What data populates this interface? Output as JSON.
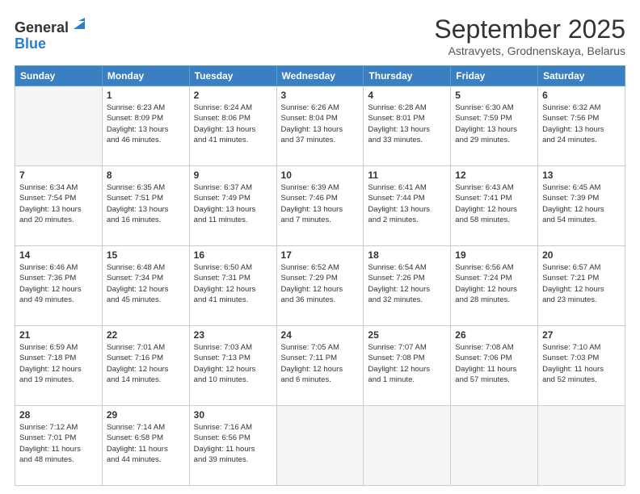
{
  "header": {
    "logo": {
      "line1": "General",
      "line2": "Blue"
    },
    "title": "September 2025",
    "subtitle": "Astravyets, Grodnenskaya, Belarus"
  },
  "calendar": {
    "weekdays": [
      "Sunday",
      "Monday",
      "Tuesday",
      "Wednesday",
      "Thursday",
      "Friday",
      "Saturday"
    ],
    "weeks": [
      [
        {
          "day": "",
          "info": ""
        },
        {
          "day": "1",
          "info": "Sunrise: 6:23 AM\nSunset: 8:09 PM\nDaylight: 13 hours\nand 46 minutes."
        },
        {
          "day": "2",
          "info": "Sunrise: 6:24 AM\nSunset: 8:06 PM\nDaylight: 13 hours\nand 41 minutes."
        },
        {
          "day": "3",
          "info": "Sunrise: 6:26 AM\nSunset: 8:04 PM\nDaylight: 13 hours\nand 37 minutes."
        },
        {
          "day": "4",
          "info": "Sunrise: 6:28 AM\nSunset: 8:01 PM\nDaylight: 13 hours\nand 33 minutes."
        },
        {
          "day": "5",
          "info": "Sunrise: 6:30 AM\nSunset: 7:59 PM\nDaylight: 13 hours\nand 29 minutes."
        },
        {
          "day": "6",
          "info": "Sunrise: 6:32 AM\nSunset: 7:56 PM\nDaylight: 13 hours\nand 24 minutes."
        }
      ],
      [
        {
          "day": "7",
          "info": "Sunrise: 6:34 AM\nSunset: 7:54 PM\nDaylight: 13 hours\nand 20 minutes."
        },
        {
          "day": "8",
          "info": "Sunrise: 6:35 AM\nSunset: 7:51 PM\nDaylight: 13 hours\nand 16 minutes."
        },
        {
          "day": "9",
          "info": "Sunrise: 6:37 AM\nSunset: 7:49 PM\nDaylight: 13 hours\nand 11 minutes."
        },
        {
          "day": "10",
          "info": "Sunrise: 6:39 AM\nSunset: 7:46 PM\nDaylight: 13 hours\nand 7 minutes."
        },
        {
          "day": "11",
          "info": "Sunrise: 6:41 AM\nSunset: 7:44 PM\nDaylight: 13 hours\nand 2 minutes."
        },
        {
          "day": "12",
          "info": "Sunrise: 6:43 AM\nSunset: 7:41 PM\nDaylight: 12 hours\nand 58 minutes."
        },
        {
          "day": "13",
          "info": "Sunrise: 6:45 AM\nSunset: 7:39 PM\nDaylight: 12 hours\nand 54 minutes."
        }
      ],
      [
        {
          "day": "14",
          "info": "Sunrise: 6:46 AM\nSunset: 7:36 PM\nDaylight: 12 hours\nand 49 minutes."
        },
        {
          "day": "15",
          "info": "Sunrise: 6:48 AM\nSunset: 7:34 PM\nDaylight: 12 hours\nand 45 minutes."
        },
        {
          "day": "16",
          "info": "Sunrise: 6:50 AM\nSunset: 7:31 PM\nDaylight: 12 hours\nand 41 minutes."
        },
        {
          "day": "17",
          "info": "Sunrise: 6:52 AM\nSunset: 7:29 PM\nDaylight: 12 hours\nand 36 minutes."
        },
        {
          "day": "18",
          "info": "Sunrise: 6:54 AM\nSunset: 7:26 PM\nDaylight: 12 hours\nand 32 minutes."
        },
        {
          "day": "19",
          "info": "Sunrise: 6:56 AM\nSunset: 7:24 PM\nDaylight: 12 hours\nand 28 minutes."
        },
        {
          "day": "20",
          "info": "Sunrise: 6:57 AM\nSunset: 7:21 PM\nDaylight: 12 hours\nand 23 minutes."
        }
      ],
      [
        {
          "day": "21",
          "info": "Sunrise: 6:59 AM\nSunset: 7:18 PM\nDaylight: 12 hours\nand 19 minutes."
        },
        {
          "day": "22",
          "info": "Sunrise: 7:01 AM\nSunset: 7:16 PM\nDaylight: 12 hours\nand 14 minutes."
        },
        {
          "day": "23",
          "info": "Sunrise: 7:03 AM\nSunset: 7:13 PM\nDaylight: 12 hours\nand 10 minutes."
        },
        {
          "day": "24",
          "info": "Sunrise: 7:05 AM\nSunset: 7:11 PM\nDaylight: 12 hours\nand 6 minutes."
        },
        {
          "day": "25",
          "info": "Sunrise: 7:07 AM\nSunset: 7:08 PM\nDaylight: 12 hours\nand 1 minute."
        },
        {
          "day": "26",
          "info": "Sunrise: 7:08 AM\nSunset: 7:06 PM\nDaylight: 11 hours\nand 57 minutes."
        },
        {
          "day": "27",
          "info": "Sunrise: 7:10 AM\nSunset: 7:03 PM\nDaylight: 11 hours\nand 52 minutes."
        }
      ],
      [
        {
          "day": "28",
          "info": "Sunrise: 7:12 AM\nSunset: 7:01 PM\nDaylight: 11 hours\nand 48 minutes."
        },
        {
          "day": "29",
          "info": "Sunrise: 7:14 AM\nSunset: 6:58 PM\nDaylight: 11 hours\nand 44 minutes."
        },
        {
          "day": "30",
          "info": "Sunrise: 7:16 AM\nSunset: 6:56 PM\nDaylight: 11 hours\nand 39 minutes."
        },
        {
          "day": "",
          "info": ""
        },
        {
          "day": "",
          "info": ""
        },
        {
          "day": "",
          "info": ""
        },
        {
          "day": "",
          "info": ""
        }
      ]
    ]
  }
}
